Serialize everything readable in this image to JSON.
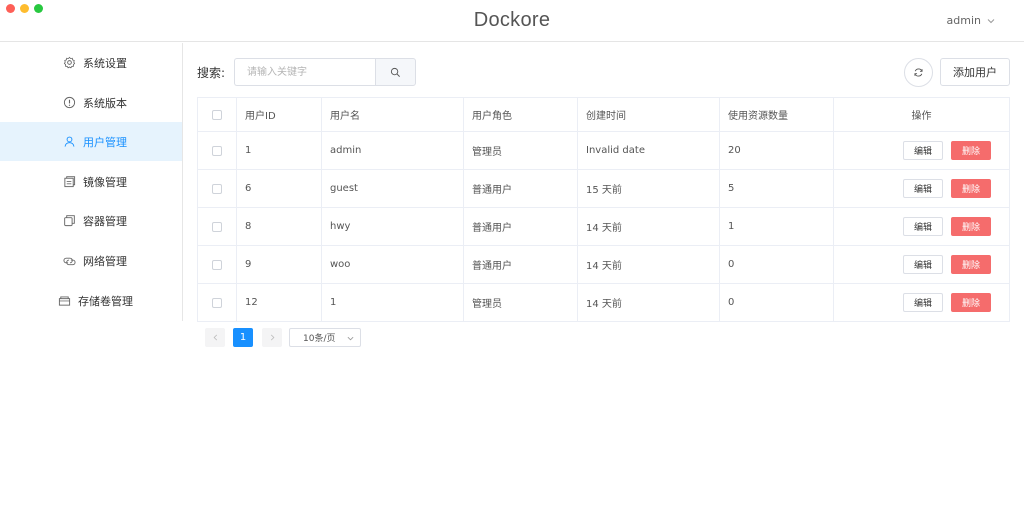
{
  "app": {
    "title": "Dockore"
  },
  "user_menu": {
    "name": "admin",
    "chevron_icon": "chevron-down-icon"
  },
  "sidebar": {
    "items": [
      {
        "label": "系统设置",
        "icon": "gear-icon",
        "active": false
      },
      {
        "label": "系统版本",
        "icon": "info-icon",
        "active": false
      },
      {
        "label": "用户管理",
        "icon": "user-icon",
        "active": true
      },
      {
        "label": "镜像管理",
        "icon": "image-icon",
        "active": false
      },
      {
        "label": "容器管理",
        "icon": "container-icon",
        "active": false
      },
      {
        "label": "网络管理",
        "icon": "network-icon",
        "active": false
      },
      {
        "label": "存储卷管理",
        "icon": "storage-icon",
        "active": false
      }
    ]
  },
  "toolbar": {
    "search_label": "搜索:",
    "search_placeholder": "请输入关键字",
    "search_value": "",
    "add_user_label": "添加用户"
  },
  "table": {
    "headers": [
      "用户ID",
      "用户名",
      "用户角色",
      "创建时间",
      "使用资源数量",
      "操作"
    ],
    "rows": [
      {
        "id": "1",
        "username": "admin",
        "role": "管理员",
        "created": "Invalid date",
        "resources": "20"
      },
      {
        "id": "6",
        "username": "guest",
        "role": "普通用户",
        "created": "15 天前",
        "resources": "5"
      },
      {
        "id": "8",
        "username": "hwy",
        "role": "普通用户",
        "created": "14 天前",
        "resources": "1"
      },
      {
        "id": "9",
        "username": "woo",
        "role": "普通用户",
        "created": "14 天前",
        "resources": "0"
      },
      {
        "id": "12",
        "username": "1",
        "role": "管理员",
        "created": "14 天前",
        "resources": "0"
      }
    ],
    "edit_label": "编辑",
    "delete_label": "删除"
  },
  "pagination": {
    "current_page": "1",
    "page_size": "10条/页"
  },
  "colors": {
    "accent": "#1890ff",
    "danger": "#f56c6c",
    "active_bg": "#e6f3fd"
  }
}
